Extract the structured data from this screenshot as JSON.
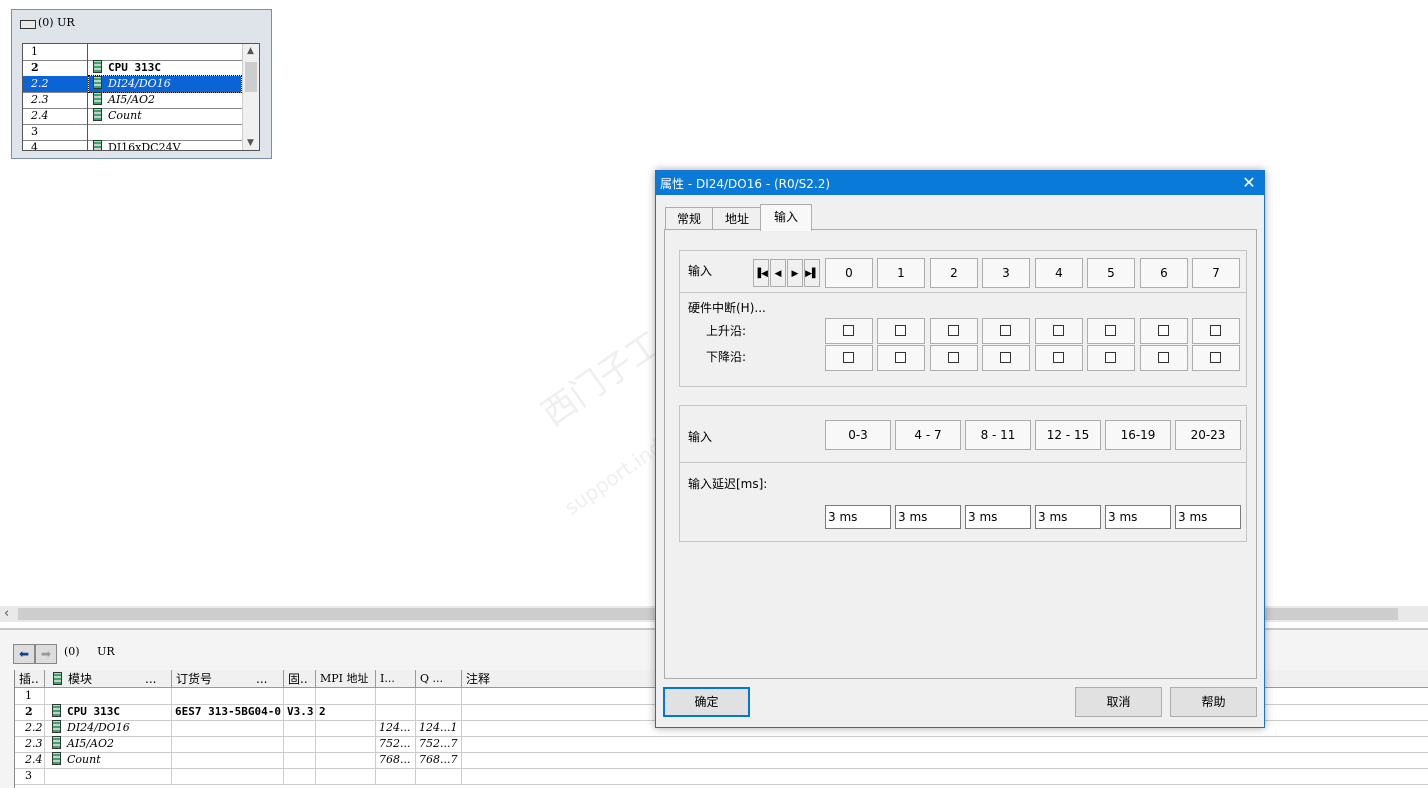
{
  "rack": {
    "title": "(0) UR",
    "rows": [
      {
        "slot": "1",
        "module": ""
      },
      {
        "slot": "2",
        "module": "CPU 313C"
      },
      {
        "slot": "2.2",
        "module": "DI24/DO16"
      },
      {
        "slot": "2.3",
        "module": "AI5/AO2"
      },
      {
        "slot": "2.4",
        "module": "Count"
      },
      {
        "slot": "3",
        "module": ""
      },
      {
        "slot": "4",
        "module": "DI16xDC24V"
      }
    ],
    "selected_slot": "2.2"
  },
  "bottom": {
    "title": "(0)     UR",
    "headers": [
      "插..",
      "模块",
      "...",
      "订货号",
      "...",
      "固..",
      "MPI 地址",
      "I...",
      "Q ...",
      "注释"
    ],
    "rows": [
      {
        "slot": "1",
        "module": "",
        "order": "",
        "fw": "",
        "mpi": "",
        "i": "",
        "q": ""
      },
      {
        "slot": "2",
        "module": "CPU 313C",
        "order": "6ES7 313-5BG04-0",
        "fw": "V3.3",
        "mpi": "2",
        "i": "",
        "q": ""
      },
      {
        "slot": "2.2",
        "module": "DI24/DO16",
        "order": "",
        "fw": "",
        "mpi": "",
        "i": "124...",
        "q": "124...1"
      },
      {
        "slot": "2.3",
        "module": "AI5/AO2",
        "order": "",
        "fw": "",
        "mpi": "",
        "i": "752...",
        "q": "752...7"
      },
      {
        "slot": "2.4",
        "module": "Count",
        "order": "",
        "fw": "",
        "mpi": "",
        "i": "768...",
        "q": "768...7"
      },
      {
        "slot": "3",
        "module": "",
        "order": "",
        "fw": "",
        "mpi": "",
        "i": "",
        "q": ""
      }
    ]
  },
  "dialog": {
    "title": "属性 - DI24/DO16 - (R0/S2.2)",
    "tabs": [
      "常规",
      "地址",
      "输入"
    ],
    "active_tab": "输入",
    "input_label": "输入",
    "channels": [
      "0",
      "1",
      "2",
      "3",
      "4",
      "5",
      "6",
      "7"
    ],
    "hw_interrupt_label": "硬件中断(H)...",
    "rising_label": "上升沿:",
    "falling_label": "下降沿:",
    "group_label": "输入",
    "groups": [
      "0-3",
      "4 - 7",
      "8 - 11",
      "12 - 15",
      "16-19",
      "20-23"
    ],
    "delay_label": "输入延迟[ms]:",
    "delays": [
      "3 ms",
      "3 ms",
      "3 ms",
      "3 ms",
      "3 ms",
      "3 ms"
    ],
    "ok": "确定",
    "cancel": "取消",
    "help": "帮助"
  },
  "watermark": {
    "line1": "西门子工业 找答案",
    "line2": "support.industry.siemens.com/cs"
  },
  "colors": {
    "titlebar": "#0a7ad8",
    "selection": "#0a64d6"
  }
}
